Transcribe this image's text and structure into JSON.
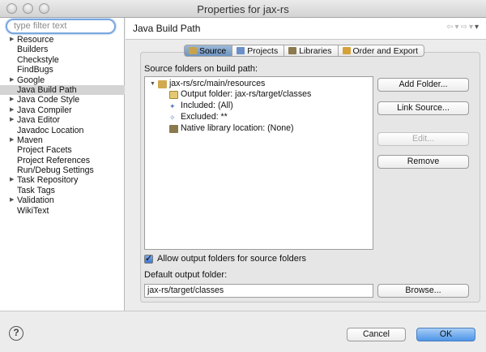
{
  "window": {
    "title": "Properties for jax-rs"
  },
  "sidebar": {
    "filter_placeholder": "type filter text",
    "items": [
      {
        "label": "Resource",
        "expandable": true
      },
      {
        "label": "Builders",
        "expandable": false
      },
      {
        "label": "Checkstyle",
        "expandable": false
      },
      {
        "label": "FindBugs",
        "expandable": false
      },
      {
        "label": "Google",
        "expandable": true
      },
      {
        "label": "Java Build Path",
        "expandable": false,
        "selected": true
      },
      {
        "label": "Java Code Style",
        "expandable": true
      },
      {
        "label": "Java Compiler",
        "expandable": true
      },
      {
        "label": "Java Editor",
        "expandable": true
      },
      {
        "label": "Javadoc Location",
        "expandable": false
      },
      {
        "label": "Maven",
        "expandable": true
      },
      {
        "label": "Project Facets",
        "expandable": false
      },
      {
        "label": "Project References",
        "expandable": false
      },
      {
        "label": "Run/Debug Settings",
        "expandable": false
      },
      {
        "label": "Task Repository",
        "expandable": true
      },
      {
        "label": "Task Tags",
        "expandable": false
      },
      {
        "label": "Validation",
        "expandable": true
      },
      {
        "label": "WikiText",
        "expandable": false
      }
    ]
  },
  "page": {
    "title": "Java Build Path",
    "tabs": [
      {
        "label": "Source",
        "active": true,
        "icon": "source-folder-icon",
        "color": "#c9a24a"
      },
      {
        "label": "Projects",
        "active": false,
        "icon": "projects-icon",
        "color": "#6b8fc9"
      },
      {
        "label": "Libraries",
        "active": false,
        "icon": "libraries-icon",
        "color": "#8a7a4e"
      },
      {
        "label": "Order and Export",
        "active": false,
        "icon": "order-export-icon",
        "color": "#d6a13a"
      }
    ],
    "source_label": "Source folders on build path:",
    "source_tree": {
      "root": "jax-rs/src/main/resources",
      "children": [
        "Output folder: jax-rs/target/classes",
        "Included: (All)",
        "Excluded: **",
        "Native library location: (None)"
      ]
    },
    "buttons": {
      "add_folder": "Add Folder...",
      "link_source": "Link Source...",
      "edit": "Edit...",
      "remove": "Remove",
      "browse": "Browse..."
    },
    "allow_output_label": "Allow output folders for source folders",
    "allow_output_checked": true,
    "default_output_label": "Default output folder:",
    "default_output_value": "jax-rs/target/classes"
  },
  "footer": {
    "help": "?",
    "cancel": "Cancel",
    "ok": "OK"
  },
  "colors": {
    "accent": "#4e95e8",
    "selection": "#d4d4d4"
  }
}
